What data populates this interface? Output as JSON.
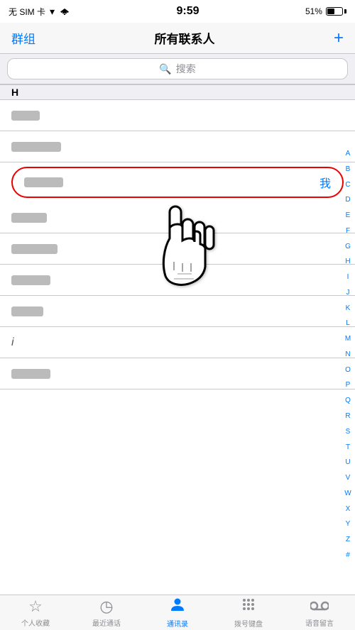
{
  "status": {
    "carrier": "无 SIM 卡",
    "wifi": "WiFi",
    "time": "9:59",
    "battery": "51%"
  },
  "nav": {
    "left_label": "群组",
    "title": "所有联系人",
    "right_label": "+"
  },
  "search": {
    "placeholder": "搜索"
  },
  "contacts": {
    "sections": [
      {
        "letter": "H",
        "items": [
          {
            "id": 1,
            "name_width": 40,
            "me": false
          },
          {
            "id": 2,
            "name_width": 70,
            "me": false
          },
          {
            "id": 3,
            "name_width": 55,
            "me": true,
            "highlighted": true
          }
        ]
      },
      {
        "letter": "",
        "items": [
          {
            "id": 4,
            "name_width": 50,
            "me": false
          },
          {
            "id": 5,
            "name_width": 65,
            "me": false
          },
          {
            "id": 6,
            "name_width": 55,
            "me": false
          },
          {
            "id": 7,
            "name_width": 45,
            "me": false
          },
          {
            "id": 8,
            "name_width": 10,
            "me": false
          },
          {
            "id": 9,
            "name_width": 55,
            "me": false
          }
        ]
      }
    ]
  },
  "alphabet": [
    "A",
    "B",
    "C",
    "D",
    "E",
    "F",
    "G",
    "H",
    "I",
    "J",
    "K",
    "L",
    "M",
    "N",
    "O",
    "P",
    "Q",
    "R",
    "S",
    "T",
    "U",
    "V",
    "W",
    "X",
    "Y",
    "Z",
    "#"
  ],
  "tabs": [
    {
      "id": "favorites",
      "icon": "★",
      "label": "个人收藏",
      "active": false
    },
    {
      "id": "recents",
      "icon": "◷",
      "label": "最近通话",
      "active": false
    },
    {
      "id": "contacts",
      "icon": "person",
      "label": "通讯录",
      "active": true
    },
    {
      "id": "keypad",
      "icon": "grid",
      "label": "拨号键盘",
      "active": false
    },
    {
      "id": "voicemail",
      "icon": "vm",
      "label": "语音留言",
      "active": false
    }
  ],
  "me_badge": "我"
}
